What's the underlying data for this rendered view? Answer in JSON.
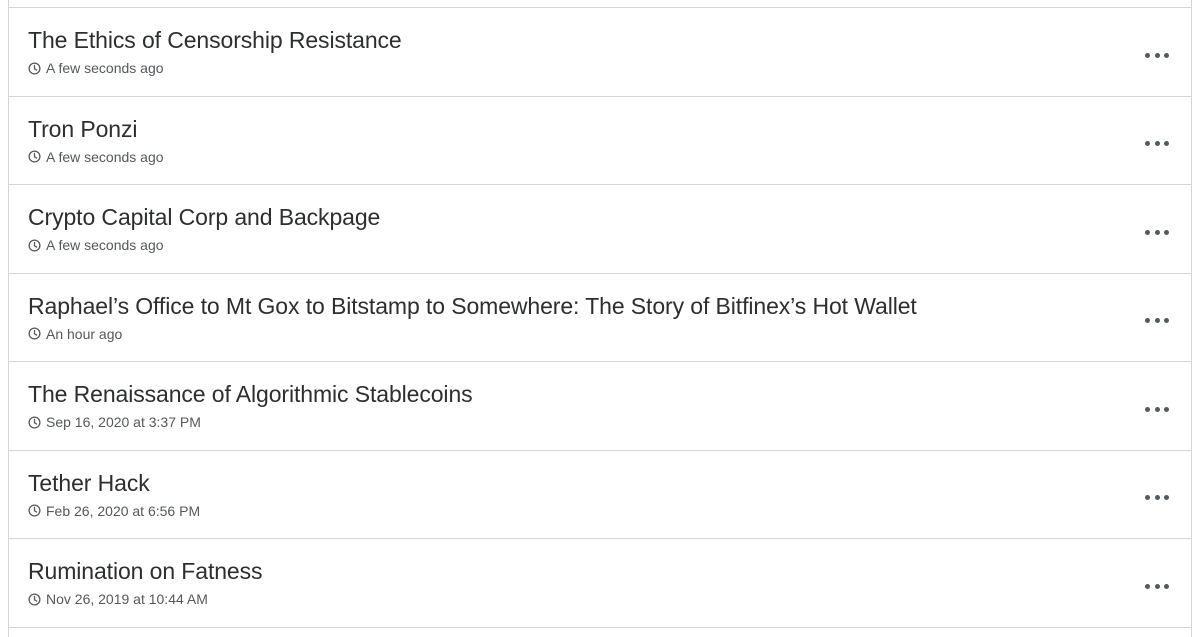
{
  "posts": [
    {
      "title": "The Ethics of Censorship Resistance",
      "time": "A few seconds ago",
      "icon": "clock-icon",
      "menu_icon": "more-options-icon"
    },
    {
      "title": "Tron Ponzi",
      "time": "A few seconds ago",
      "icon": "clock-icon",
      "menu_icon": "more-options-icon"
    },
    {
      "title": "Crypto Capital Corp and Backpage",
      "time": "A few seconds ago",
      "icon": "clock-icon",
      "menu_icon": "more-options-icon"
    },
    {
      "title": "Raphael’s Office to Mt Gox to Bitstamp to Somewhere: The Story of Bitfinex’s Hot Wallet",
      "time": "An hour ago",
      "icon": "clock-icon",
      "menu_icon": "more-options-icon"
    },
    {
      "title": "The Renaissance of Algorithmic Stablecoins",
      "time": "Sep 16, 2020 at 3:37 PM",
      "icon": "clock-icon",
      "menu_icon": "more-options-icon"
    },
    {
      "title": "Tether Hack",
      "time": "Feb 26, 2020 at 6:56 PM",
      "icon": "clock-icon",
      "menu_icon": "more-options-icon"
    },
    {
      "title": "Rumination on Fatness",
      "time": "Nov 26, 2019 at 10:44 AM",
      "icon": "clock-icon",
      "menu_icon": "more-options-icon"
    }
  ],
  "colors": {
    "border": "#d7d7d9",
    "title": "#2c2e30",
    "meta": "#55585c",
    "menu_dots": "#555a5f"
  }
}
